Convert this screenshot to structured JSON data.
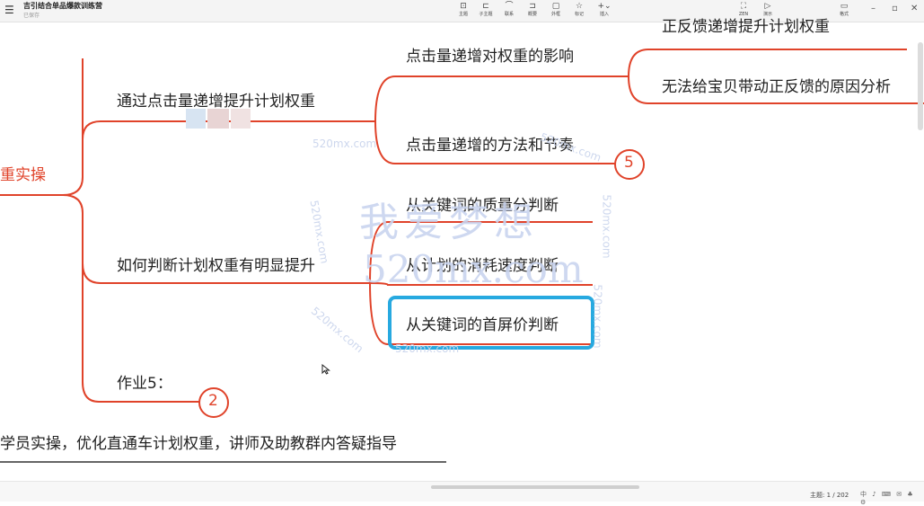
{
  "app": {
    "menu_icon": "hamburger-icon",
    "title": "吉引结合单品爆款训练营",
    "subtitle": "已保存"
  },
  "toolbar": [
    {
      "label": "主题",
      "icon": "topic-icon",
      "glyph": "⊡"
    },
    {
      "label": "子主题",
      "icon": "subtopic-icon",
      "glyph": "⊏"
    },
    {
      "label": "联系",
      "icon": "relation-icon",
      "glyph": "⌒"
    },
    {
      "label": "概要",
      "icon": "summary-icon",
      "glyph": "⊐"
    },
    {
      "label": "外框",
      "icon": "boundary-icon",
      "glyph": "▢"
    },
    {
      "label": "标记",
      "icon": "marker-icon",
      "glyph": "☆"
    },
    {
      "label": "插入",
      "icon": "insert-icon",
      "glyph": "+⌄"
    },
    {
      "label": "ZEN",
      "icon": "zen-icon",
      "glyph": "⛶"
    },
    {
      "label": "演示",
      "icon": "present-icon",
      "glyph": "▷"
    },
    {
      "label": "格式",
      "icon": "format-icon",
      "glyph": "▭"
    }
  ],
  "window": {
    "minimize": "–",
    "restore": "▫",
    "close": "✕"
  },
  "mindmap": {
    "root_partial": "重实操",
    "branches": {
      "b1": "通过点击量递增提升计划权重",
      "b2": "如何判断计划权重有明显提升",
      "b3": "作业5："
    },
    "b1_children": {
      "c1": "点击量递增对权重的影响",
      "c2": "点击量递增的方法和节奏"
    },
    "c1_children": {
      "top_cut": "正反馈递增提升计划权重",
      "d2": "无法给宝贝带动正反馈的原因分析"
    },
    "b2_children": {
      "e1": "从关键词的质量分判断",
      "e2": "从计划的消耗速度判断",
      "e3": "从关键词的首屏价判断"
    },
    "homework": "学员实操，优化直通车计划权重，讲师及助教群内答疑指导",
    "badges": {
      "fold_c1": "5",
      "fold_b3": "2"
    }
  },
  "watermark": {
    "big_cn": "我爱梦想",
    "big_en": "520mx.com",
    "small": "520mx.com"
  },
  "statusbar": {
    "topic_count": "主题: 1 / 202",
    "tray": "中 ♪ ⌨ ✉ ♣ ⚙"
  },
  "colors": {
    "accent": "#e0432a",
    "highlight": "#27a9e0",
    "badge": "#e0432a"
  }
}
